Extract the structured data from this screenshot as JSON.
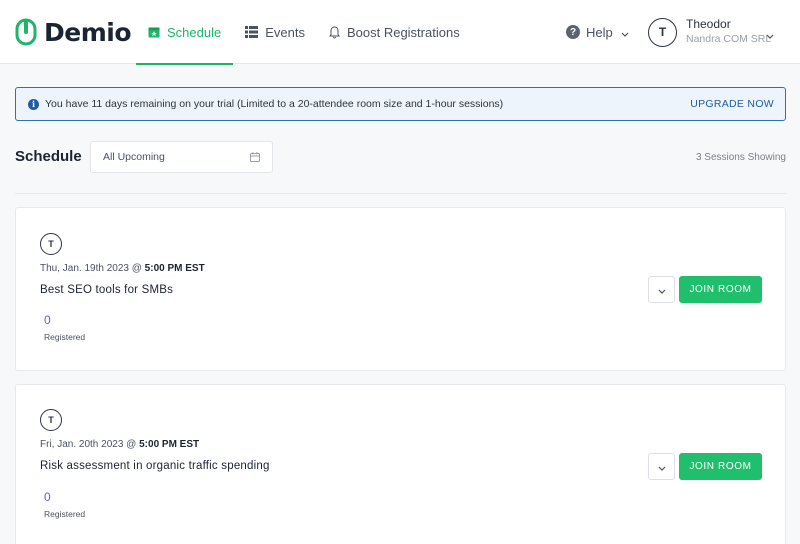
{
  "app": {
    "name": "Demio"
  },
  "nav": {
    "tabs": [
      {
        "label": "Schedule",
        "icon": "calendar-star-icon",
        "active": true
      },
      {
        "label": "Events",
        "icon": "list-icon",
        "active": false
      },
      {
        "label": "Boost Registrations",
        "icon": "bell-icon",
        "active": false
      }
    ]
  },
  "help": {
    "label": "Help"
  },
  "user": {
    "initial": "T",
    "name": "Theodor",
    "org": "Nandra COM SRL"
  },
  "banner": {
    "message": "You have 11 days remaining on your trial (Limited to a 20-attendee room size and 1-hour sessions)",
    "action": "UPGRADE NOW"
  },
  "schedule": {
    "title": "Schedule",
    "filter_value": "All Upcoming",
    "sessions_count": "3 Sessions Showing"
  },
  "sessions": [
    {
      "host_initial": "T",
      "date": "Thu, Jan. 19th 2023 @",
      "time": "5:00 PM EST",
      "title": "Best SEO tools for SMBs",
      "registered": "0",
      "registered_label": "Registered",
      "join_label": "JOIN ROOM"
    },
    {
      "host_initial": "T",
      "date": "Fri, Jan. 20th 2023 @",
      "time": "5:00 PM EST",
      "title": "Risk assessment in organic traffic spending",
      "registered": "0",
      "registered_label": "Registered",
      "join_label": "JOIN ROOM"
    }
  ],
  "colors": {
    "brand": "#1fb46a",
    "join": "#1fbf6e",
    "info": "#1f5ca8",
    "registered": "#6b56d6"
  }
}
